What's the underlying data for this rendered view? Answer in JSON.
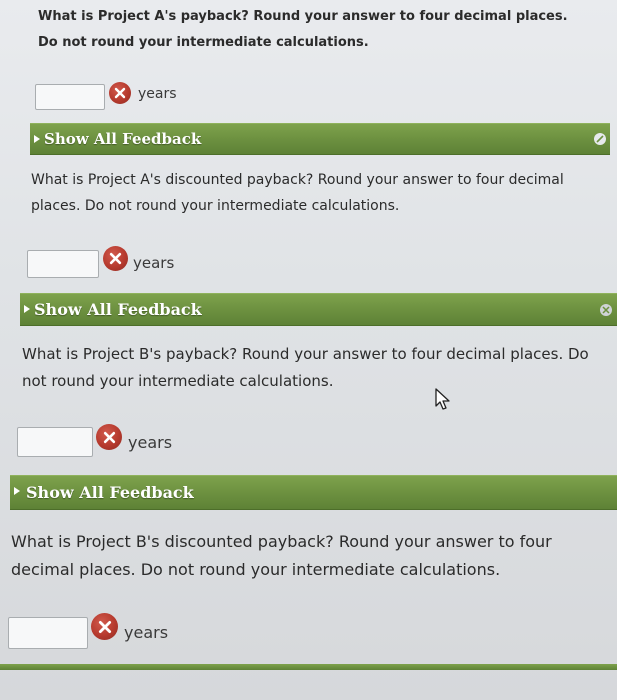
{
  "questions": [
    {
      "text": "What is Project A's payback? Round your answer to four decimal places. Do not round your intermediate calculations.",
      "answer_value": "",
      "unit": "years"
    },
    {
      "text": "What is Project A's discounted payback? Round your answer to four decimal places. Do not round your intermediate calculations.",
      "answer_value": "",
      "unit": "years"
    },
    {
      "text": "What is Project B's payback? Round your answer to four decimal places. Do not round your intermediate calculations.",
      "answer_value": "",
      "unit": "years"
    },
    {
      "text": "What is Project B's discounted payback? Round your answer to four decimal places. Do not round your intermediate calculations.",
      "answer_value": "",
      "unit": "years"
    }
  ],
  "feedback": {
    "label": "Show All Feedback"
  },
  "icons": {
    "incorrect": "x-circle-icon",
    "expand": "triangle-right-icon",
    "corner_1": "edit-icon",
    "corner_2": "close-icon",
    "cursor": "mouse-pointer-icon"
  },
  "colors": {
    "feedback_bar": "#6d9140",
    "incorrect_badge": "#b63a2e",
    "text": "#2b2b2b",
    "background": "#e5e7ea"
  }
}
